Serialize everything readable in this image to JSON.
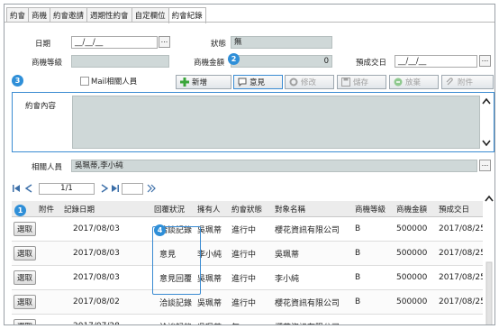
{
  "tabs": [
    "約會",
    "商機",
    "約會邀請",
    "週期性約會",
    "自定欄位",
    "約會紀錄"
  ],
  "form": {
    "date_label": "日期",
    "date_value": "__/__/__",
    "status_label": "狀態",
    "status_value": "無",
    "level_label": "商機等級",
    "level_value": "",
    "amount_label": "商機金額",
    "amount_value": "0",
    "deal_label": "預成交日",
    "deal_value": "__/__/__",
    "dots": "...",
    "mail_label": "Mail相關人員",
    "content_label": "約會內容",
    "related_label": "相關人員",
    "related_value": "吳珮蒂,李小純"
  },
  "toolbar": {
    "add": "新增",
    "opinion": "意見",
    "edit": "修改",
    "save": "儲存",
    "discard": "放棄",
    "attach": "附件"
  },
  "badges": {
    "one": "1",
    "two": "2",
    "three": "3",
    "four": "4"
  },
  "pager": {
    "page": "1/1"
  },
  "grid": {
    "columns": [
      "附件",
      "記錄日期",
      "回覆狀況",
      "擁有人",
      "約會狀態",
      "對象名稱",
      "商機等級",
      "商機金額",
      "預成交日"
    ],
    "pick_label": "選取",
    "rows": [
      {
        "date": "2017/08/03",
        "reply": "洽談記錄",
        "owner": "吳珮蒂",
        "state": "進行中",
        "target": "櫻花資訊有限公司",
        "level": "B",
        "amount": "500000",
        "deal": "2017/08/25"
      },
      {
        "date": "2017/08/03",
        "reply": "意見",
        "owner": "李小純",
        "state": "進行中",
        "target": "吳珮蒂",
        "level": "B",
        "amount": "500000",
        "deal": "2017/08/25"
      },
      {
        "date": "2017/08/03",
        "reply": "意見回覆",
        "owner": "吳珮蒂",
        "state": "進行中",
        "target": "李小純",
        "level": "B",
        "amount": "500000",
        "deal": "2017/08/25"
      },
      {
        "date": "2017/08/02",
        "reply": "洽談記錄",
        "owner": "吳珮蒂",
        "state": "進行中",
        "target": "櫻花資訊有限公司",
        "level": "B",
        "amount": "500000",
        "deal": "2017/08/25"
      },
      {
        "date": "2017/07/28",
        "reply": "洽談記錄",
        "owner": "吳珮蒂",
        "state": "無",
        "target": "櫻花資訊有限公司",
        "level": "",
        "amount": "",
        "deal": ""
      }
    ]
  },
  "colors": {
    "accent": "#3a8bd2",
    "field_bg": "#cfd8d8",
    "badge": "#2f8fd8"
  }
}
